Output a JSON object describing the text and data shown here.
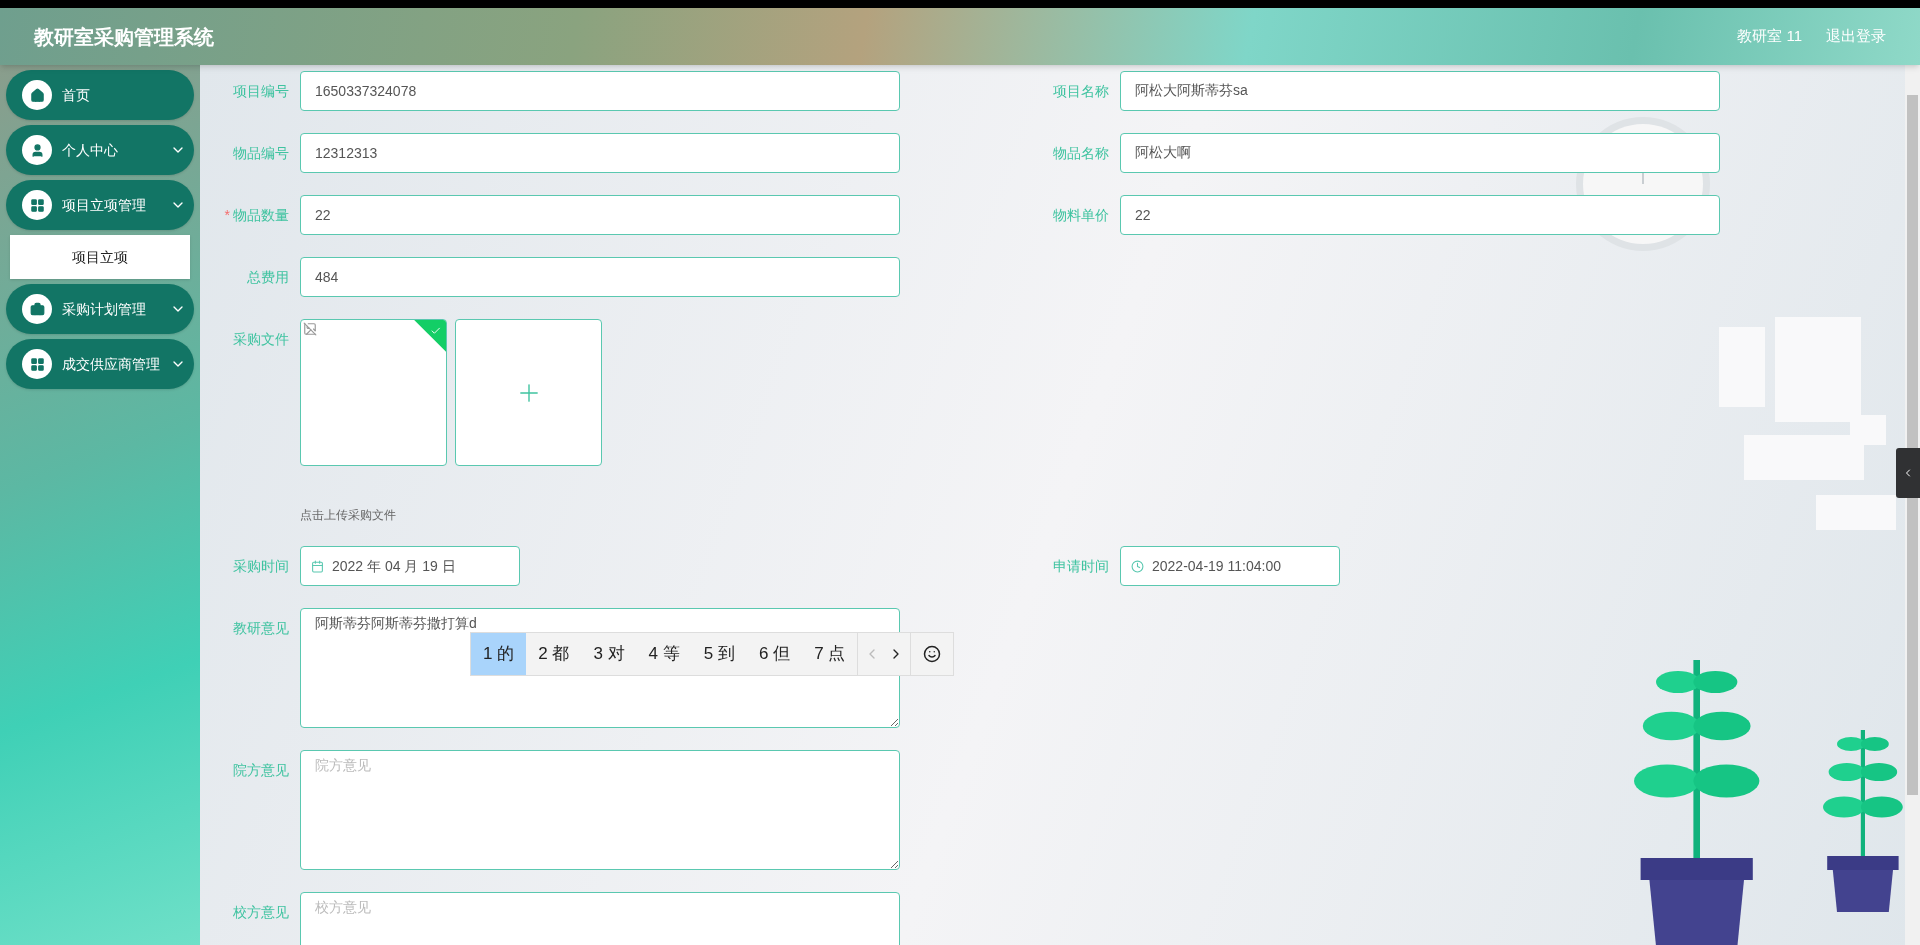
{
  "header": {
    "title": "教研室采购管理系统",
    "user": "教研室 11",
    "logout": "退出登录"
  },
  "sidebar": {
    "items": [
      {
        "label": "首页",
        "kind": "link"
      },
      {
        "label": "个人中心",
        "kind": "menu"
      },
      {
        "label": "项目立项管理",
        "kind": "menu",
        "children": [
          {
            "label": "项目立项",
            "selected": true
          }
        ]
      },
      {
        "label": "采购计划管理",
        "kind": "menu"
      },
      {
        "label": "成交供应商管理",
        "kind": "menu"
      }
    ]
  },
  "form": {
    "rows": [
      {
        "fields": [
          {
            "label": "项目编号",
            "kind": "text",
            "value": "1650337324078"
          },
          {
            "label": "项目名称",
            "kind": "text",
            "value": "阿松大阿斯蒂芬sa"
          }
        ]
      },
      {
        "fields": [
          {
            "label": "物品编号",
            "kind": "text",
            "value": "12312313"
          },
          {
            "label": "物品名称",
            "kind": "text",
            "value": "阿松大啊"
          }
        ]
      },
      {
        "fields": [
          {
            "label": "物品数量",
            "kind": "text",
            "value": "22",
            "required_mark": "*"
          },
          {
            "label": "物料单价",
            "kind": "text",
            "value": "22"
          }
        ]
      },
      {
        "fields": [
          {
            "label": "总费用",
            "kind": "text",
            "value": "484"
          }
        ]
      },
      {
        "fields": [
          {
            "label": "采购文件",
            "kind": "upload",
            "files": [
              {
                "uploaded": true
              }
            ],
            "hint": "点击上传采购文件"
          }
        ]
      },
      {
        "fields": [
          {
            "label": "采购时间",
            "kind": "date",
            "value": "2022 年 04 月 19 日"
          },
          {
            "label": "申请时间",
            "kind": "datetime",
            "value": "2022-04-19 11:04:00"
          }
        ]
      },
      {
        "fields": [
          {
            "label": "教研意见",
            "kind": "textarea",
            "value": "阿斯蒂芬阿斯蒂芬撒打算d"
          }
        ]
      },
      {
        "fields": [
          {
            "label": "院方意见",
            "kind": "textarea",
            "placeholder": "院方意见"
          }
        ]
      },
      {
        "fields": [
          {
            "label": "校方意见",
            "kind": "textarea",
            "placeholder": "校方意见"
          }
        ]
      }
    ]
  },
  "ime": {
    "candidates": [
      {
        "label": "1 的",
        "selected": true
      },
      {
        "label": "2 都",
        "selected": false
      },
      {
        "label": "3 对",
        "selected": false
      },
      {
        "label": "4 等",
        "selected": false
      },
      {
        "label": "5 到",
        "selected": false
      },
      {
        "label": "6 但",
        "selected": false
      },
      {
        "label": "7 点",
        "selected": false
      }
    ],
    "prev_enabled": false,
    "next_enabled": true
  }
}
